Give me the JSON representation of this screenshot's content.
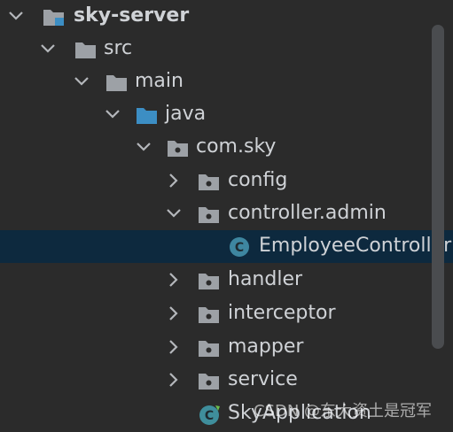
{
  "colors": {
    "background": "#2b2b2b",
    "selected_row": "#0d293e",
    "text": "#cfd2d6",
    "folder": "#9da1a6",
    "java_folder": "#3c8ec4",
    "class_icon": "#3e86a0",
    "app_icon": "#3f8e9c",
    "chevron": "#b4b7bb",
    "scrollbar": "#4a4c4f"
  },
  "tree": [
    {
      "label": "sky-server",
      "chevron": "open",
      "icon": "module-folder-icon",
      "bold": true
    },
    {
      "label": "src",
      "chevron": "open",
      "icon": "folder-icon"
    },
    {
      "label": "main",
      "chevron": "open",
      "icon": "folder-icon"
    },
    {
      "label": "java",
      "chevron": "open",
      "icon": "source-root-folder-icon"
    },
    {
      "label": "com.sky",
      "chevron": "open",
      "icon": "package-icon"
    },
    {
      "label": "config",
      "chevron": "closed",
      "icon": "package-icon"
    },
    {
      "label": "controller.admin",
      "chevron": "open",
      "icon": "package-icon"
    },
    {
      "label": "EmployeeController",
      "chevron": "none",
      "icon": "class-icon",
      "selected": true
    },
    {
      "label": "handler",
      "chevron": "closed",
      "icon": "package-icon"
    },
    {
      "label": "interceptor",
      "chevron": "closed",
      "icon": "package-icon"
    },
    {
      "label": "mapper",
      "chevron": "closed",
      "icon": "package-icon"
    },
    {
      "label": "service",
      "chevron": "closed",
      "icon": "package-icon"
    },
    {
      "label": "SkyApplication",
      "chevron": "none",
      "icon": "spring-boot-class-icon"
    }
  ],
  "watermark": "CSDN @东大资土是冠军"
}
